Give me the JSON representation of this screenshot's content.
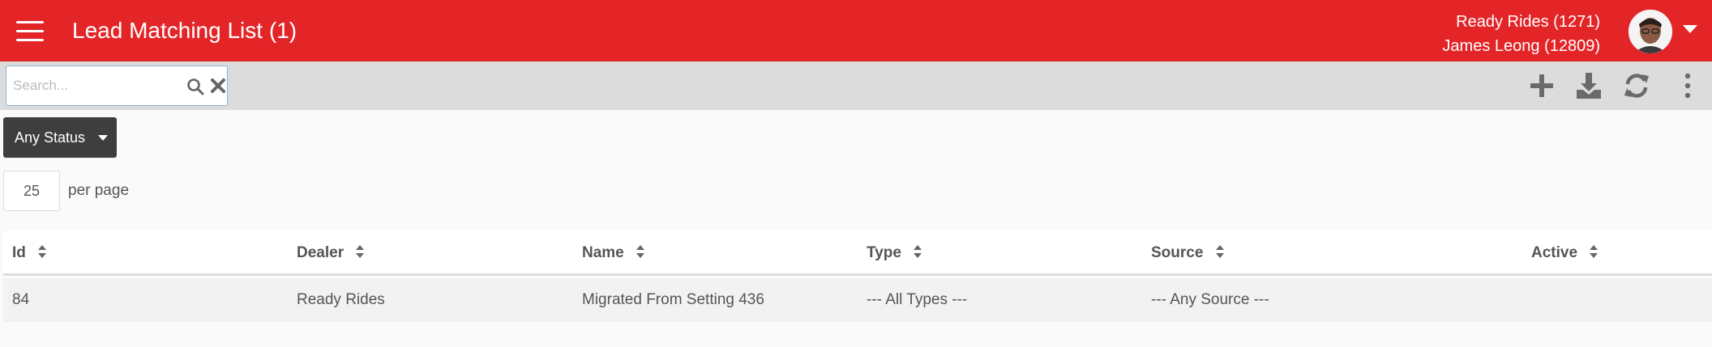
{
  "header": {
    "title": "Lead Matching List (1)",
    "dealer_line": "Ready Rides (1271)",
    "user_line": "James Leong (12809)",
    "background_color": "#e42528"
  },
  "toolbar": {
    "search_placeholder": "Search...",
    "search_value": "",
    "icons": [
      "search-icon",
      "clear-icon",
      "add-icon",
      "download-icon",
      "refresh-icon",
      "more-vertical-icon"
    ]
  },
  "filters": {
    "status_label": "Any Status",
    "per_page_value": "25",
    "per_page_label": "per page"
  },
  "table": {
    "columns": [
      "Id",
      "Dealer",
      "Name",
      "Type",
      "Source",
      "Active"
    ],
    "rows": [
      {
        "id": "84",
        "dealer": "Ready Rides",
        "name": "Migrated From Setting 436",
        "type": "--- All Types ---",
        "source": "--- Any Source ---",
        "active": ""
      }
    ]
  }
}
